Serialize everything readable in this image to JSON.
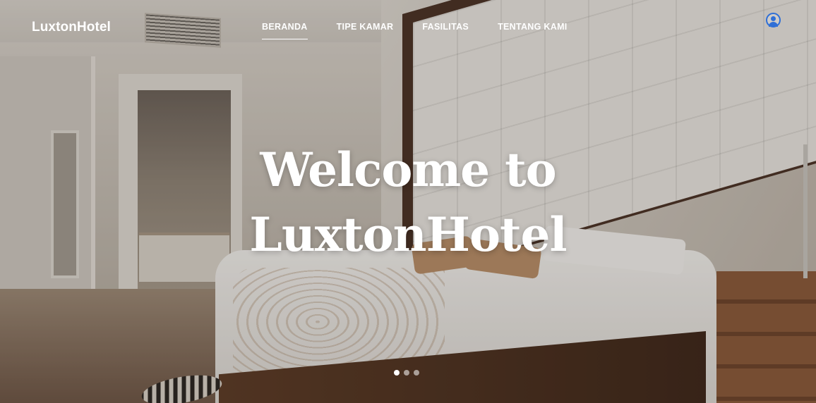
{
  "brand": {
    "name": "LuxtonHotel"
  },
  "nav": {
    "items": [
      {
        "label": "BERANDA",
        "active": true
      },
      {
        "label": "TIPE KAMAR",
        "active": false
      },
      {
        "label": "FASILITAS",
        "active": false
      },
      {
        "label": "TENTANG KAMI",
        "active": false
      }
    ],
    "account_icon": "user-circle-icon"
  },
  "hero": {
    "title_line1": "Welcome to",
    "title_line2": "LuxtonHotel",
    "background": "hotel bedroom photo"
  },
  "carousel": {
    "slides": 3,
    "active_index": 0
  },
  "colors": {
    "accent": "#2f6fd6",
    "text_on_image": "#ffffff"
  }
}
